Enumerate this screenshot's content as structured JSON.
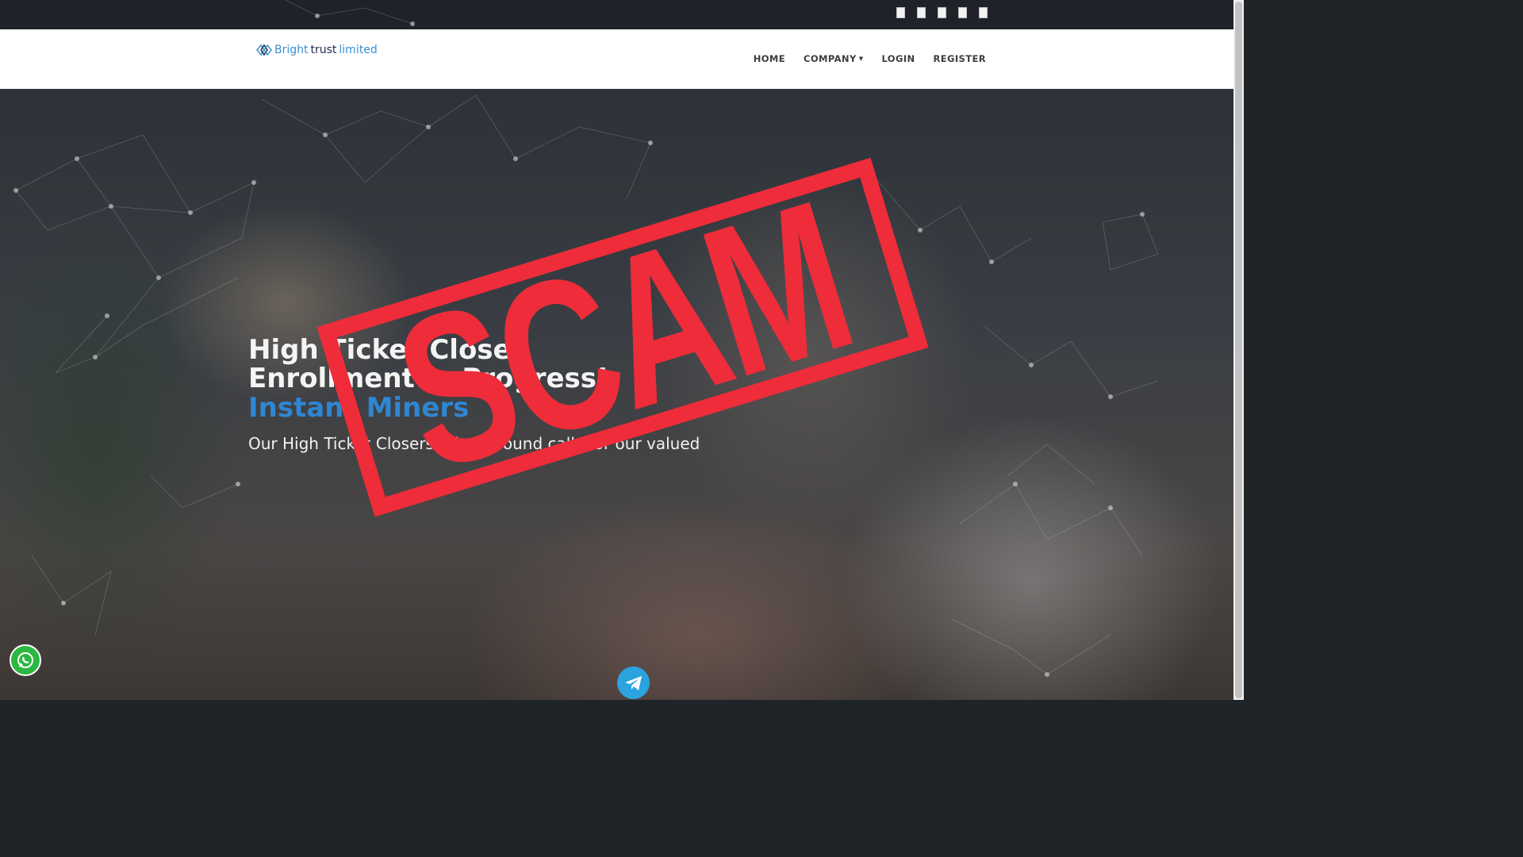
{
  "topbar": {
    "social_icons": [
      "social-icon-1",
      "social-icon-2",
      "social-icon-3",
      "social-icon-4",
      "social-icon-5"
    ]
  },
  "brand": {
    "name_part1": "Bright",
    "name_part2": "trust",
    "name_part3": "limited",
    "colors": {
      "accent": "#3b8fd0",
      "dark": "#1b2b46"
    }
  },
  "nav": {
    "home": "HOME",
    "company": "COMPANY",
    "login": "LOGIN",
    "register": "REGISTER"
  },
  "hero": {
    "title": "High Ticket Closer Enrollment in Progress!",
    "highlight": "Instant Miners",
    "subtitle": "Our High Ticket Closers take inbound calls for our valued"
  },
  "stamp": {
    "text": "SCAM",
    "color": "#ee2c3a"
  },
  "floating": {
    "whatsapp_icon": "whatsapp-icon",
    "telegram_icon": "telegram-icon"
  }
}
